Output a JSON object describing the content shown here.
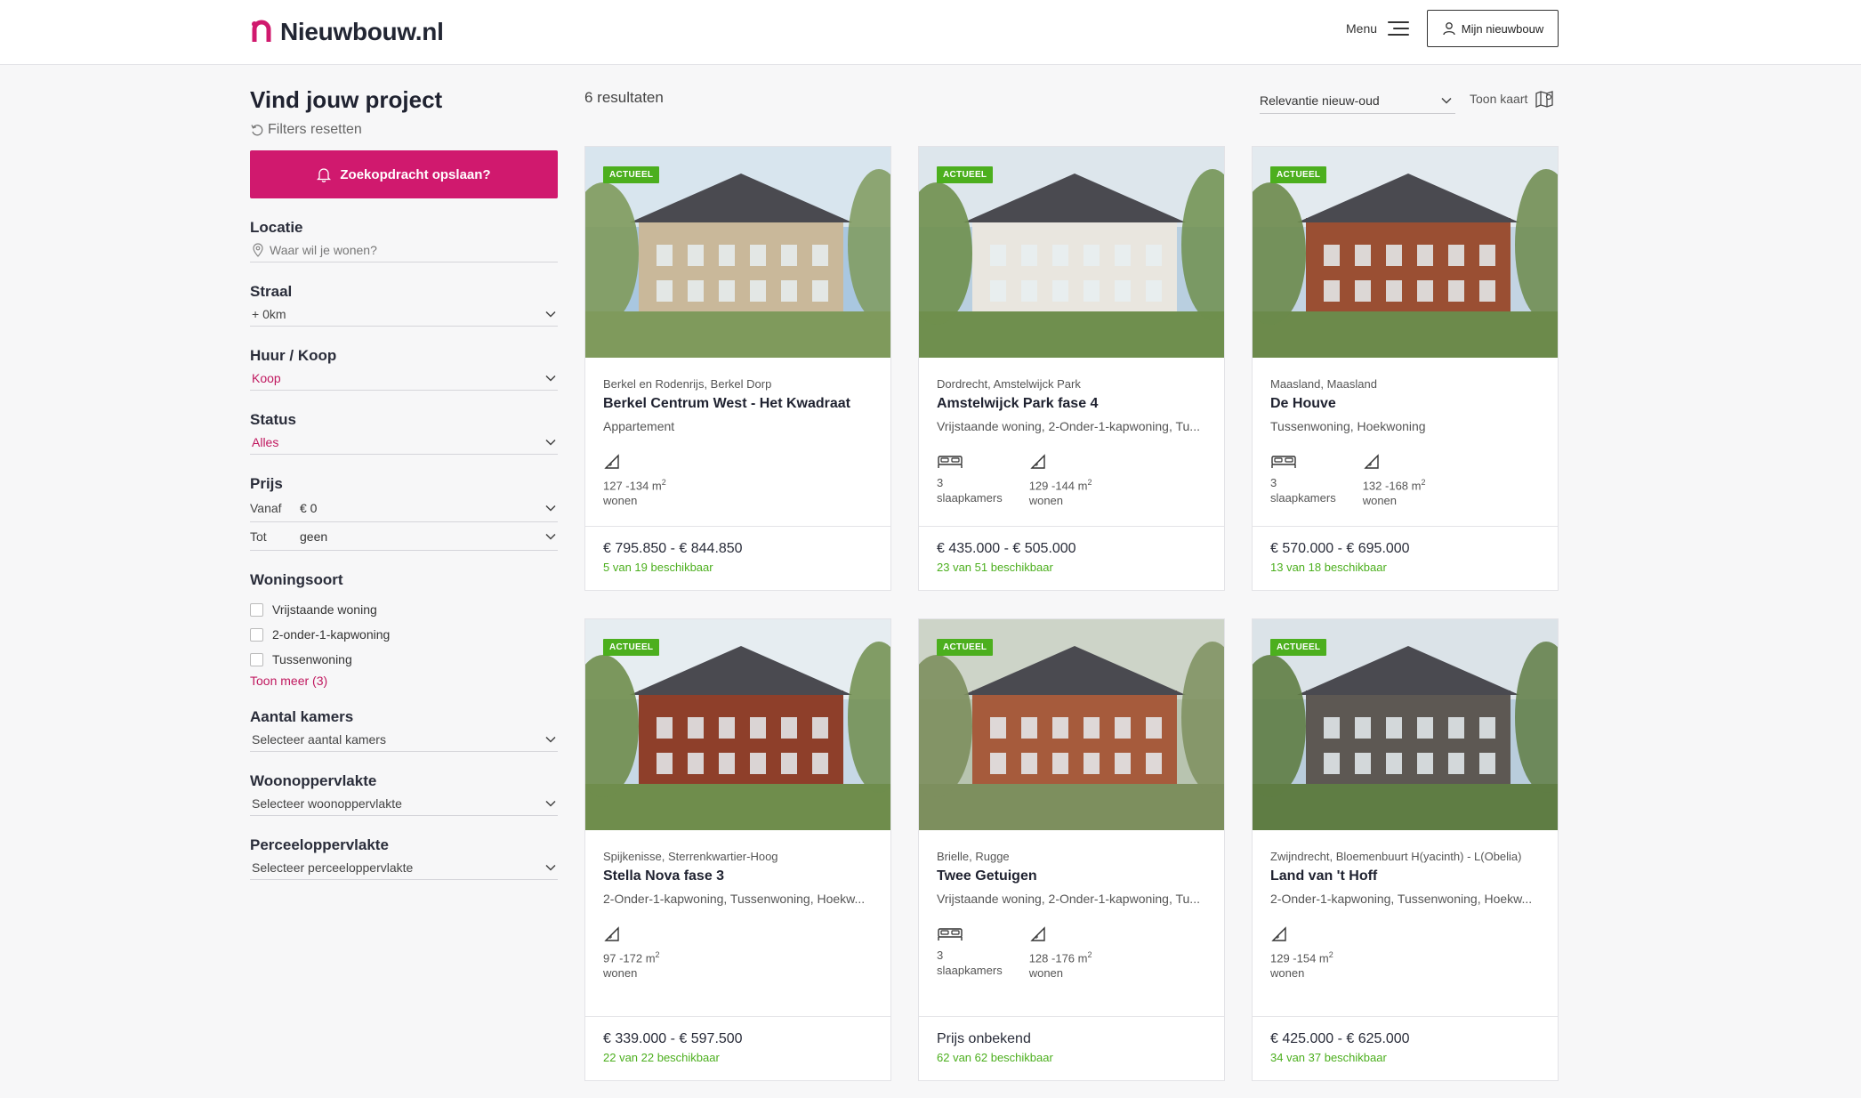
{
  "header": {
    "logo_text": "Nieuwbouw.nl",
    "menu_label": "Menu",
    "account_label": "Mijn nieuwbouw"
  },
  "sidebar": {
    "title": "Vind jouw project",
    "reset_label": "Filters resetten",
    "save_search_label": "Zoekopdracht opslaan?",
    "locatie": {
      "label": "Locatie",
      "placeholder": "Waar wil je wonen?"
    },
    "straal": {
      "label": "Straal",
      "value": "+ 0km"
    },
    "huur_koop": {
      "label": "Huur / Koop",
      "value": "Koop"
    },
    "status": {
      "label": "Status",
      "value": "Alles"
    },
    "prijs": {
      "label": "Prijs",
      "vanaf_label": "Vanaf",
      "vanaf_value": "€ 0",
      "tot_label": "Tot",
      "tot_value": "geen"
    },
    "woningsoort": {
      "label": "Woningsoort",
      "options": [
        "Vrijstaande woning",
        "2-onder-1-kapwoning",
        "Tussenwoning"
      ],
      "more_label": "Toon meer (3)"
    },
    "kamers": {
      "label": "Aantal kamers",
      "value": "Selecteer aantal kamers"
    },
    "woonopp": {
      "label": "Woonoppervlakte",
      "value": "Selecteer woonoppervlakte"
    },
    "perceelopp": {
      "label": "Perceeloppervlakte",
      "value": "Selecteer perceeloppervlakte"
    }
  },
  "results": {
    "count_label": "6 resultaten",
    "sort_value": "Relevantie nieuw-oud",
    "map_label": "Toon kaart"
  },
  "cards": [
    {
      "badge": "ACTUEEL",
      "location": "Berkel en Rodenrijs, Berkel Dorp",
      "name": "Berkel Centrum West - Het Kwadraat",
      "types": "Appartement",
      "bedrooms": "",
      "bedrooms_label": "",
      "area": "127 -134 m",
      "area_label": "wonen",
      "price": "€ 795.850 - € 844.850",
      "availability": "5 van 19 beschikbaar"
    },
    {
      "badge": "ACTUEEL",
      "location": "Dordrecht, Amstelwijck Park",
      "name": "Amstelwijck Park fase 4",
      "types": "Vrijstaande woning, 2-Onder-1-kapwoning, Tu...",
      "bedrooms": "3",
      "bedrooms_label": "slaapkamers",
      "area": "129 -144 m",
      "area_label": "wonen",
      "price": "€ 435.000 - € 505.000",
      "availability": "23 van 51 beschikbaar"
    },
    {
      "badge": "ACTUEEL",
      "location": "Maasland, Maasland",
      "name": "De Houve",
      "types": "Tussenwoning, Hoekwoning",
      "bedrooms": "3",
      "bedrooms_label": "slaapkamers",
      "area": "132 -168 m",
      "area_label": "wonen",
      "price": "€ 570.000 - € 695.000",
      "availability": "13 van 18 beschikbaar"
    },
    {
      "badge": "ACTUEEL",
      "location": "Spijkenisse, Sterrenkwartier-Hoog",
      "name": "Stella Nova fase 3",
      "types": "2-Onder-1-kapwoning, Tussenwoning, Hoekw...",
      "bedrooms": "",
      "bedrooms_label": "",
      "area": "97 -172 m",
      "area_label": "wonen",
      "price": "€ 339.000 - € 597.500",
      "availability": "22 van 22 beschikbaar"
    },
    {
      "badge": "ACTUEEL",
      "location": "Brielle, Rugge",
      "name": "Twee Getuigen",
      "types": "Vrijstaande woning, 2-Onder-1-kapwoning, Tu...",
      "bedrooms": "3",
      "bedrooms_label": "slaapkamers",
      "area": "128 -176 m",
      "area_label": "wonen",
      "price": "Prijs onbekend",
      "availability": "62 van 62 beschikbaar"
    },
    {
      "badge": "ACTUEEL",
      "location": "Zwijndrecht, Bloemenbuurt H(yacinth) - L(Obelia)",
      "name": "Land van 't Hoff",
      "types": "2-Onder-1-kapwoning, Tussenwoning, Hoekw...",
      "bedrooms": "",
      "bedrooms_label": "",
      "area": "129 -154 m",
      "area_label": "wonen",
      "price": "€ 425.000 - € 625.000",
      "availability": "34 van 37 beschikbaar"
    }
  ],
  "area_unit_sup": "2",
  "colors": {
    "brand": "#d0196e",
    "available": "#4caf1e",
    "text": "#1f2230"
  }
}
